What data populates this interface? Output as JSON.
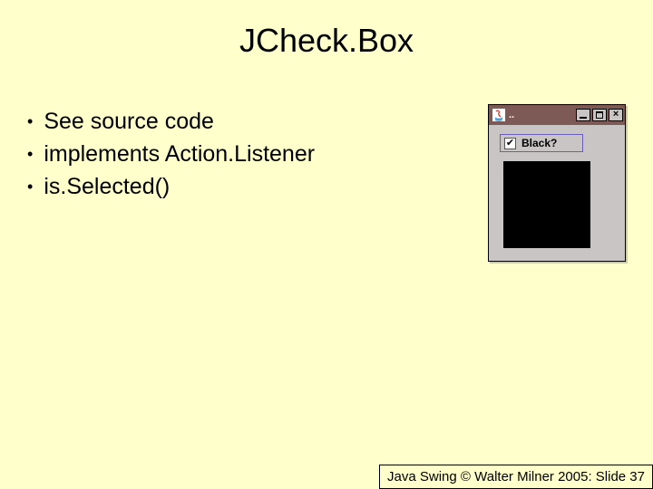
{
  "title": "JCheck.Box",
  "bullets": [
    "See source code",
    "implements Action.Listener",
    "is.Selected()"
  ],
  "swing": {
    "window_title": "..",
    "checkbox_label": "Black?",
    "checked": true
  },
  "footer": "Java Swing © Walter Milner 2005: Slide 37"
}
